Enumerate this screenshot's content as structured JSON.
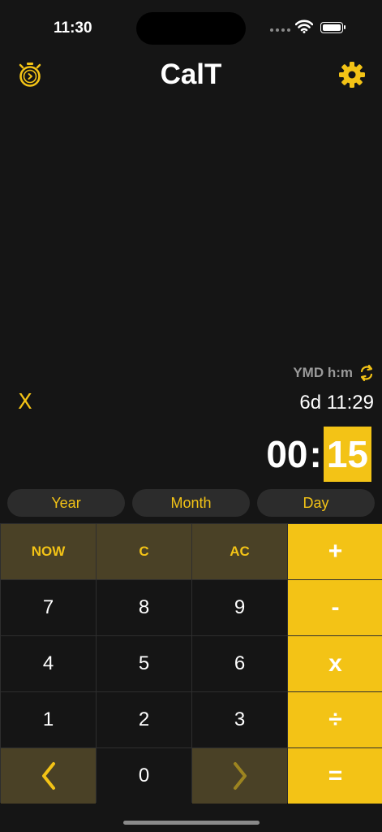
{
  "status": {
    "time": "11:30"
  },
  "header": {
    "title": "CalT",
    "timer_icon": "stopwatch-icon",
    "settings_icon": "gear-icon"
  },
  "display": {
    "format_label": "YMD h:m",
    "clear_label": "X",
    "result": "6d 11:29",
    "entry_hours": "00",
    "entry_colon": ":",
    "entry_minutes": "15"
  },
  "units": [
    "Year",
    "Month",
    "Day"
  ],
  "keypad": {
    "now": "NOW",
    "clear": "C",
    "all_clear": "AC",
    "plus": "+",
    "minus": "-",
    "multiply": "x",
    "divide": "÷",
    "equals": "=",
    "digits": [
      "7",
      "8",
      "9",
      "4",
      "5",
      "6",
      "1",
      "2",
      "3",
      "0"
    ]
  },
  "colors": {
    "accent": "#f3c316",
    "func_bg": "#4a4126",
    "background": "#151515"
  }
}
